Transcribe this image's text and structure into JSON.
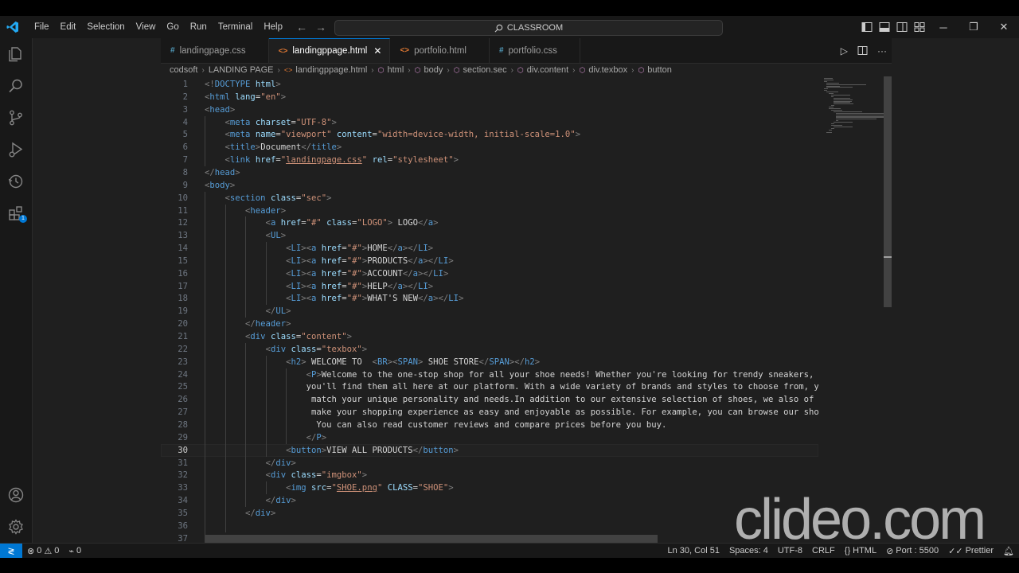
{
  "menu": [
    "File",
    "Edit",
    "Selection",
    "View",
    "Go",
    "Run",
    "Terminal",
    "Help"
  ],
  "command_center": "CLASSROOM",
  "tabs": [
    {
      "label": "landingpage.css",
      "icon": "#",
      "type": "css"
    },
    {
      "label": "landingppage.html",
      "icon": "<>",
      "type": "html",
      "active": true
    },
    {
      "label": "portfolio.html",
      "icon": "<>",
      "type": "html"
    },
    {
      "label": "portfolio.css",
      "icon": "#",
      "type": "css"
    }
  ],
  "tab_close_symbol": "✕",
  "breadcrumb": [
    "codsoft",
    "LANDING PAGE",
    "landingppage.html",
    "html",
    "body",
    "section.sec",
    "div.content",
    "div.texbox",
    "button"
  ],
  "lines": [
    {
      "n": "1",
      "indent": 0,
      "html": "<span class='t'>&lt;!</span><span class='tn'>DOCTYPE</span> <span class='an'>html</span><span class='t'>&gt;</span>"
    },
    {
      "n": "2",
      "indent": 0,
      "html": "<span class='t'>&lt;</span><span class='tn'>html</span> <span class='an'>lang</span><span class='tx'>=</span><span class='av'>\"en\"</span><span class='t'>&gt;</span>"
    },
    {
      "n": "3",
      "indent": 0,
      "html": "<span class='t'>&lt;</span><span class='tn'>head</span><span class='t'>&gt;</span>"
    },
    {
      "n": "4",
      "indent": 1,
      "html": "<span class='t'>&lt;</span><span class='tn'>meta</span> <span class='an'>charset</span><span class='tx'>=</span><span class='av'>\"UTF-8\"</span><span class='t'>&gt;</span>"
    },
    {
      "n": "5",
      "indent": 1,
      "html": "<span class='t'>&lt;</span><span class='tn'>meta</span> <span class='an'>name</span><span class='tx'>=</span><span class='av'>\"viewport\"</span> <span class='an'>content</span><span class='tx'>=</span><span class='av'>\"width=device-width, initial-scale=1.0\"</span><span class='t'>&gt;</span>"
    },
    {
      "n": "6",
      "indent": 1,
      "html": "<span class='t'>&lt;</span><span class='tn'>title</span><span class='t'>&gt;</span><span class='tx'>Document</span><span class='t'>&lt;/</span><span class='tn'>title</span><span class='t'>&gt;</span>"
    },
    {
      "n": "7",
      "indent": 1,
      "html": "<span class='t'>&lt;</span><span class='tn'>link</span> <span class='an'>href</span><span class='tx'>=</span><span class='av'>\"<span class='ul'>landingpage.css</span>\"</span> <span class='an'>rel</span><span class='tx'>=</span><span class='av'>\"stylesheet\"</span><span class='t'>&gt;</span>"
    },
    {
      "n": "8",
      "indent": 0,
      "html": "<span class='t'>&lt;/</span><span class='tn'>head</span><span class='t'>&gt;</span>"
    },
    {
      "n": "9",
      "indent": 0,
      "html": "<span class='t'>&lt;</span><span class='tn'>body</span><span class='t'>&gt;</span>"
    },
    {
      "n": "10",
      "indent": 1,
      "html": "<span class='t'>&lt;</span><span class='tn'>section</span> <span class='an'>class</span><span class='tx'>=</span><span class='av'>\"sec\"</span><span class='t'>&gt;</span>"
    },
    {
      "n": "11",
      "indent": 2,
      "html": "<span class='t'>&lt;</span><span class='tn'>header</span><span class='t'>&gt;</span>"
    },
    {
      "n": "12",
      "indent": 3,
      "html": "<span class='t'>&lt;</span><span class='tn'>a</span> <span class='an'>href</span><span class='tx'>=</span><span class='av'>\"#\"</span> <span class='an'>class</span><span class='tx'>=</span><span class='av'>\"LOGO\"</span><span class='t'>&gt;</span><span class='tx'> LOGO</span><span class='t'>&lt;/</span><span class='tn'>a</span><span class='t'>&gt;</span>"
    },
    {
      "n": "13",
      "indent": 3,
      "html": "<span class='t'>&lt;</span><span class='tn'>UL</span><span class='t'>&gt;</span>"
    },
    {
      "n": "14",
      "indent": 4,
      "html": "<span class='t'>&lt;</span><span class='tn'>LI</span><span class='t'>&gt;&lt;</span><span class='tn'>a</span> <span class='an'>href</span><span class='tx'>=</span><span class='av'>\"#\"</span><span class='t'>&gt;</span><span class='tx'>HOME</span><span class='t'>&lt;/</span><span class='tn'>a</span><span class='t'>&gt;&lt;/</span><span class='tn'>LI</span><span class='t'>&gt;</span>"
    },
    {
      "n": "15",
      "indent": 4,
      "html": "<span class='t'>&lt;</span><span class='tn'>LI</span><span class='t'>&gt;&lt;</span><span class='tn'>a</span> <span class='an'>href</span><span class='tx'>=</span><span class='av'>\"#\"</span><span class='t'>&gt;</span><span class='tx'>PRODUCTS</span><span class='t'>&lt;/</span><span class='tn'>a</span><span class='t'>&gt;&lt;/</span><span class='tn'>LI</span><span class='t'>&gt;</span>"
    },
    {
      "n": "16",
      "indent": 4,
      "html": "<span class='t'>&lt;</span><span class='tn'>LI</span><span class='t'>&gt;&lt;</span><span class='tn'>a</span> <span class='an'>href</span><span class='tx'>=</span><span class='av'>\"#\"</span><span class='t'>&gt;</span><span class='tx'>ACCOUNT</span><span class='t'>&lt;/</span><span class='tn'>a</span><span class='t'>&gt;&lt;/</span><span class='tn'>LI</span><span class='t'>&gt;</span>"
    },
    {
      "n": "17",
      "indent": 4,
      "html": "<span class='t'>&lt;</span><span class='tn'>LI</span><span class='t'>&gt;&lt;</span><span class='tn'>a</span> <span class='an'>href</span><span class='tx'>=</span><span class='av'>\"#\"</span><span class='t'>&gt;</span><span class='tx'>HELP</span><span class='t'>&lt;/</span><span class='tn'>a</span><span class='t'>&gt;&lt;/</span><span class='tn'>LI</span><span class='t'>&gt;</span>"
    },
    {
      "n": "18",
      "indent": 4,
      "html": "<span class='t'>&lt;</span><span class='tn'>LI</span><span class='t'>&gt;&lt;</span><span class='tn'>a</span> <span class='an'>href</span><span class='tx'>=</span><span class='av'>\"#\"</span><span class='t'>&gt;</span><span class='tx'>WHAT'S NEW</span><span class='t'>&lt;/</span><span class='tn'>a</span><span class='t'>&gt;&lt;/</span><span class='tn'>LI</span><span class='t'>&gt;</span>"
    },
    {
      "n": "19",
      "indent": 3,
      "html": "<span class='t'>&lt;/</span><span class='tn'>UL</span><span class='t'>&gt;</span>"
    },
    {
      "n": "20",
      "indent": 2,
      "html": "<span class='t'>&lt;/</span><span class='tn'>header</span><span class='t'>&gt;</span>"
    },
    {
      "n": "21",
      "indent": 2,
      "html": "<span class='t'>&lt;</span><span class='tn'>div</span> <span class='an'>class</span><span class='tx'>=</span><span class='av'>\"content\"</span><span class='t'>&gt;</span>"
    },
    {
      "n": "22",
      "indent": 3,
      "html": "<span class='t'>&lt;</span><span class='tn'>div</span> <span class='an'>class</span><span class='tx'>=</span><span class='av'>\"texbox\"</span><span class='t'>&gt;</span>"
    },
    {
      "n": "23",
      "indent": 4,
      "html": "<span class='t'>&lt;</span><span class='tn'>h2</span><span class='t'>&gt;</span><span class='tx'> WELCOME TO  </span><span class='t'>&lt;</span><span class='tn'>BR</span><span class='t'>&gt;&lt;</span><span class='tn'>SPAN</span><span class='t'>&gt;</span><span class='tx'> SHOE STORE</span><span class='t'>&lt;/</span><span class='tn'>SPAN</span><span class='t'>&gt;&lt;/</span><span class='tn'>h2</span><span class='t'>&gt;</span>"
    },
    {
      "n": "24",
      "indent": 5,
      "html": "<span class='t'>&lt;</span><span class='tn'>P</span><span class='t'>&gt;</span><span class='tx'>Welcome to the one-stop shop for all your shoe needs! Whether you're looking for trendy sneakers,</span>"
    },
    {
      "n": "25",
      "indent": 5,
      "html": "<span class='tx'>you'll find them all here at our platform. With a wide variety of brands and styles to choose from, y</span>"
    },
    {
      "n": "26",
      "indent": 5,
      "html": "<span class='tx'> match your unique personality and needs.In addition to our extensive selection of shoes, we also of</span>"
    },
    {
      "n": "27",
      "indent": 5,
      "html": "<span class='tx'> make your shopping experience as easy and enjoyable as possible. For example, you can browse our sho</span>"
    },
    {
      "n": "28",
      "indent": 5,
      "html": "<span class='tx'>  You can also read customer reviews and compare prices before you buy.</span>"
    },
    {
      "n": "29",
      "indent": 5,
      "html": "<span class='t'>&lt;/</span><span class='tn'>P</span><span class='t'>&gt;</span>"
    },
    {
      "n": "30",
      "indent": 4,
      "current": true,
      "html": "<span class='t'>&lt;</span><span class='tn'>button</span><span class='t'>&gt;</span><span class='tx'>VIEW ALL PRODUCTS</span><span class='t'>&lt;/</span><span class='tn'>button</span><span class='t'>&gt;</span>"
    },
    {
      "n": "31",
      "indent": 3,
      "html": "<span class='t'>&lt;/</span><span class='tn'>div</span><span class='t'>&gt;</span>"
    },
    {
      "n": "32",
      "indent": 3,
      "html": "<span class='t'>&lt;</span><span class='tn'>div</span> <span class='an'>class</span><span class='tx'>=</span><span class='av'>\"imgbox\"</span><span class='t'>&gt;</span>"
    },
    {
      "n": "33",
      "indent": 4,
      "html": "<span class='t'>&lt;</span><span class='tn'>img</span> <span class='an'>src</span><span class='tx'>=</span><span class='av'>\"<span class='ul'>SHOE.png</span>\"</span> <span class='an'>CLASS</span><span class='tx'>=</span><span class='av'>\"SHOE\"</span><span class='t'>&gt;</span>"
    },
    {
      "n": "34",
      "indent": 3,
      "html": "<span class='t'>&lt;/</span><span class='tn'>div</span><span class='t'>&gt;</span>"
    },
    {
      "n": "35",
      "indent": 2,
      "html": "<span class='t'>&lt;/</span><span class='tn'>div</span><span class='t'>&gt;</span>"
    },
    {
      "n": "36",
      "indent": 2,
      "html": ""
    },
    {
      "n": "37",
      "indent": 1,
      "html": "<span class='t'>&lt;/</span><span class='tn'>section</span><span class='t'>&gt;</span>"
    }
  ],
  "status": {
    "problems_errors": "0",
    "problems_warnings": "0",
    "ports": "0",
    "cursor": "Ln 30, Col 51",
    "spaces": "Spaces: 4",
    "encoding": "UTF-8",
    "eol": "CRLF",
    "language": "HTML",
    "port": "Port : 5500",
    "formatter": "Prettier"
  },
  "activity_badge": "1",
  "watermark": "clideo.com",
  "colors": {
    "accent": "#0078d4",
    "tag": "#569cd6",
    "attr": "#9cdcfe",
    "string": "#ce9178",
    "bracket": "#808080"
  }
}
